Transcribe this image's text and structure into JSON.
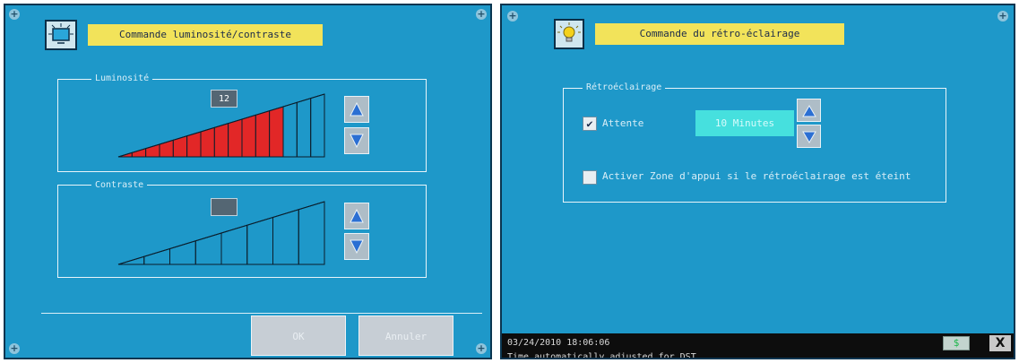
{
  "left_panel": {
    "title": "Commande luminosité/contraste",
    "brightness": {
      "legend": "Luminosité",
      "value": "12",
      "level": 12,
      "steps": 15
    },
    "contrast": {
      "legend": "Contraste",
      "value": "",
      "level": 0,
      "steps": 8
    },
    "buttons": {
      "ok": "OK",
      "cancel": "Annuler"
    },
    "icons": {
      "title": "monitor-settings-icon",
      "up": "up-arrow-icon",
      "down": "down-arrow-icon"
    },
    "colors": {
      "screen": "#1e98c9",
      "title_bar": "#f2e35a",
      "ramp_fill": "#e22727"
    }
  },
  "right_panel": {
    "title": "Commande du rétro-éclairage",
    "group_legend": "Rétroéclairage",
    "wait": {
      "label": "Attente",
      "checked": true,
      "check_mark": "✔",
      "value": "10 Minutes"
    },
    "activate_zone": {
      "label": "Activer Zone d'appui si le rétroéclairage est éteint",
      "checked": false
    },
    "status": {
      "datetime": "03/24/2010 18:06:06",
      "message": "Time automatically adjusted for DST.",
      "indicator": "$",
      "close": "X"
    },
    "icons": {
      "title": "lightbulb-icon"
    }
  }
}
